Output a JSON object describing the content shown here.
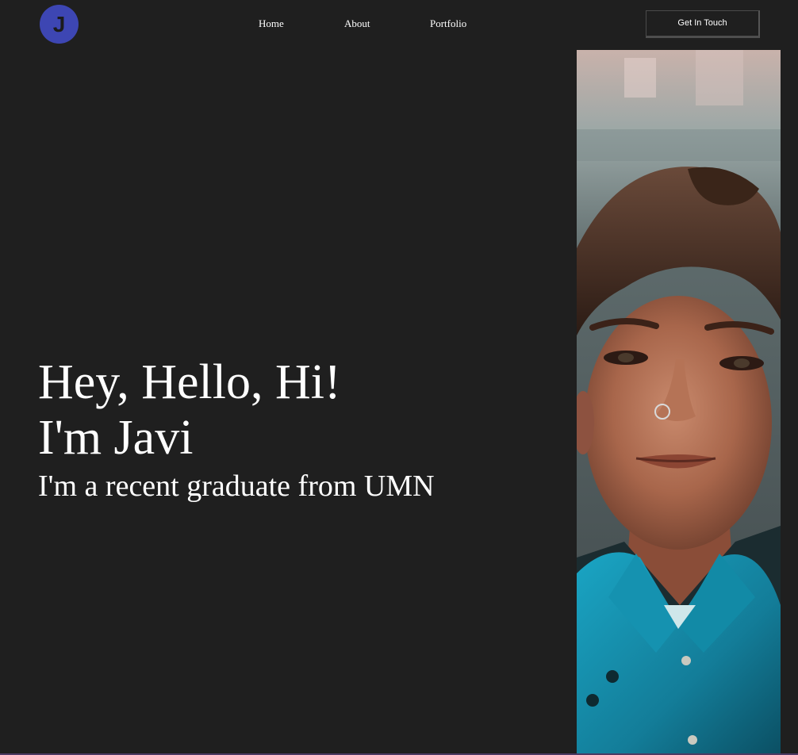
{
  "logo": {
    "letter": "J"
  },
  "nav": {
    "items": [
      {
        "label": "Home"
      },
      {
        "label": "About"
      },
      {
        "label": "Portfolio"
      }
    ],
    "cta_label": "Get In Touch"
  },
  "hero": {
    "greeting": "Hey, Hello, Hi!",
    "name": "I'm Javi",
    "tagline": "I'm a recent graduate from UMN"
  },
  "colors": {
    "background": "#1f1f1f",
    "logo_circle": "#3d46b3",
    "text": "#ffffff",
    "shirt": "#1592b0"
  }
}
